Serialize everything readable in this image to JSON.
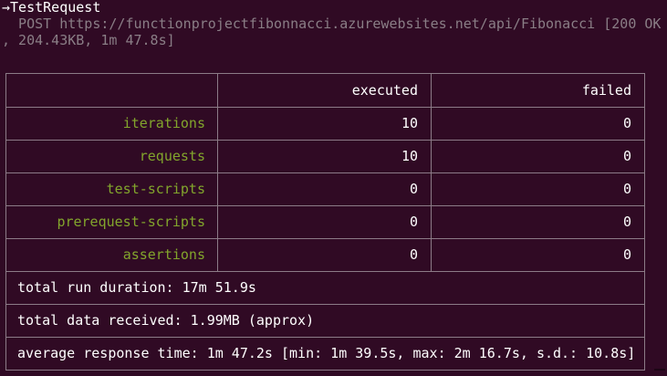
{
  "request": {
    "arrow": "→",
    "name": "TestRequest",
    "line1": "  POST https://functionprojectfibonnacci.azurewebsites.net/api/Fibonacci [200 OK",
    "line2": ", 204.43KB, 1m 47.8s]"
  },
  "table": {
    "headers": [
      "",
      "executed",
      "failed"
    ],
    "rows": [
      {
        "label": "iterations",
        "executed": "10",
        "failed": "0"
      },
      {
        "label": "requests",
        "executed": "10",
        "failed": "0"
      },
      {
        "label": "test-scripts",
        "executed": "0",
        "failed": "0"
      },
      {
        "label": "prerequest-scripts",
        "executed": "0",
        "failed": "0"
      },
      {
        "label": "assertions",
        "executed": "0",
        "failed": "0"
      }
    ],
    "summary": [
      "total run duration: 17m 51.9s",
      "total data received: 1.99MB (approx)",
      "average response time: 1m 47.2s [min: 1m 39.5s, max: 2m 16.7s, s.d.: 10.8s]"
    ]
  },
  "colors": {
    "background": "#300a24",
    "label": "#82a52c",
    "dim_text": "#8a7e86",
    "border": "#8c7b87"
  }
}
